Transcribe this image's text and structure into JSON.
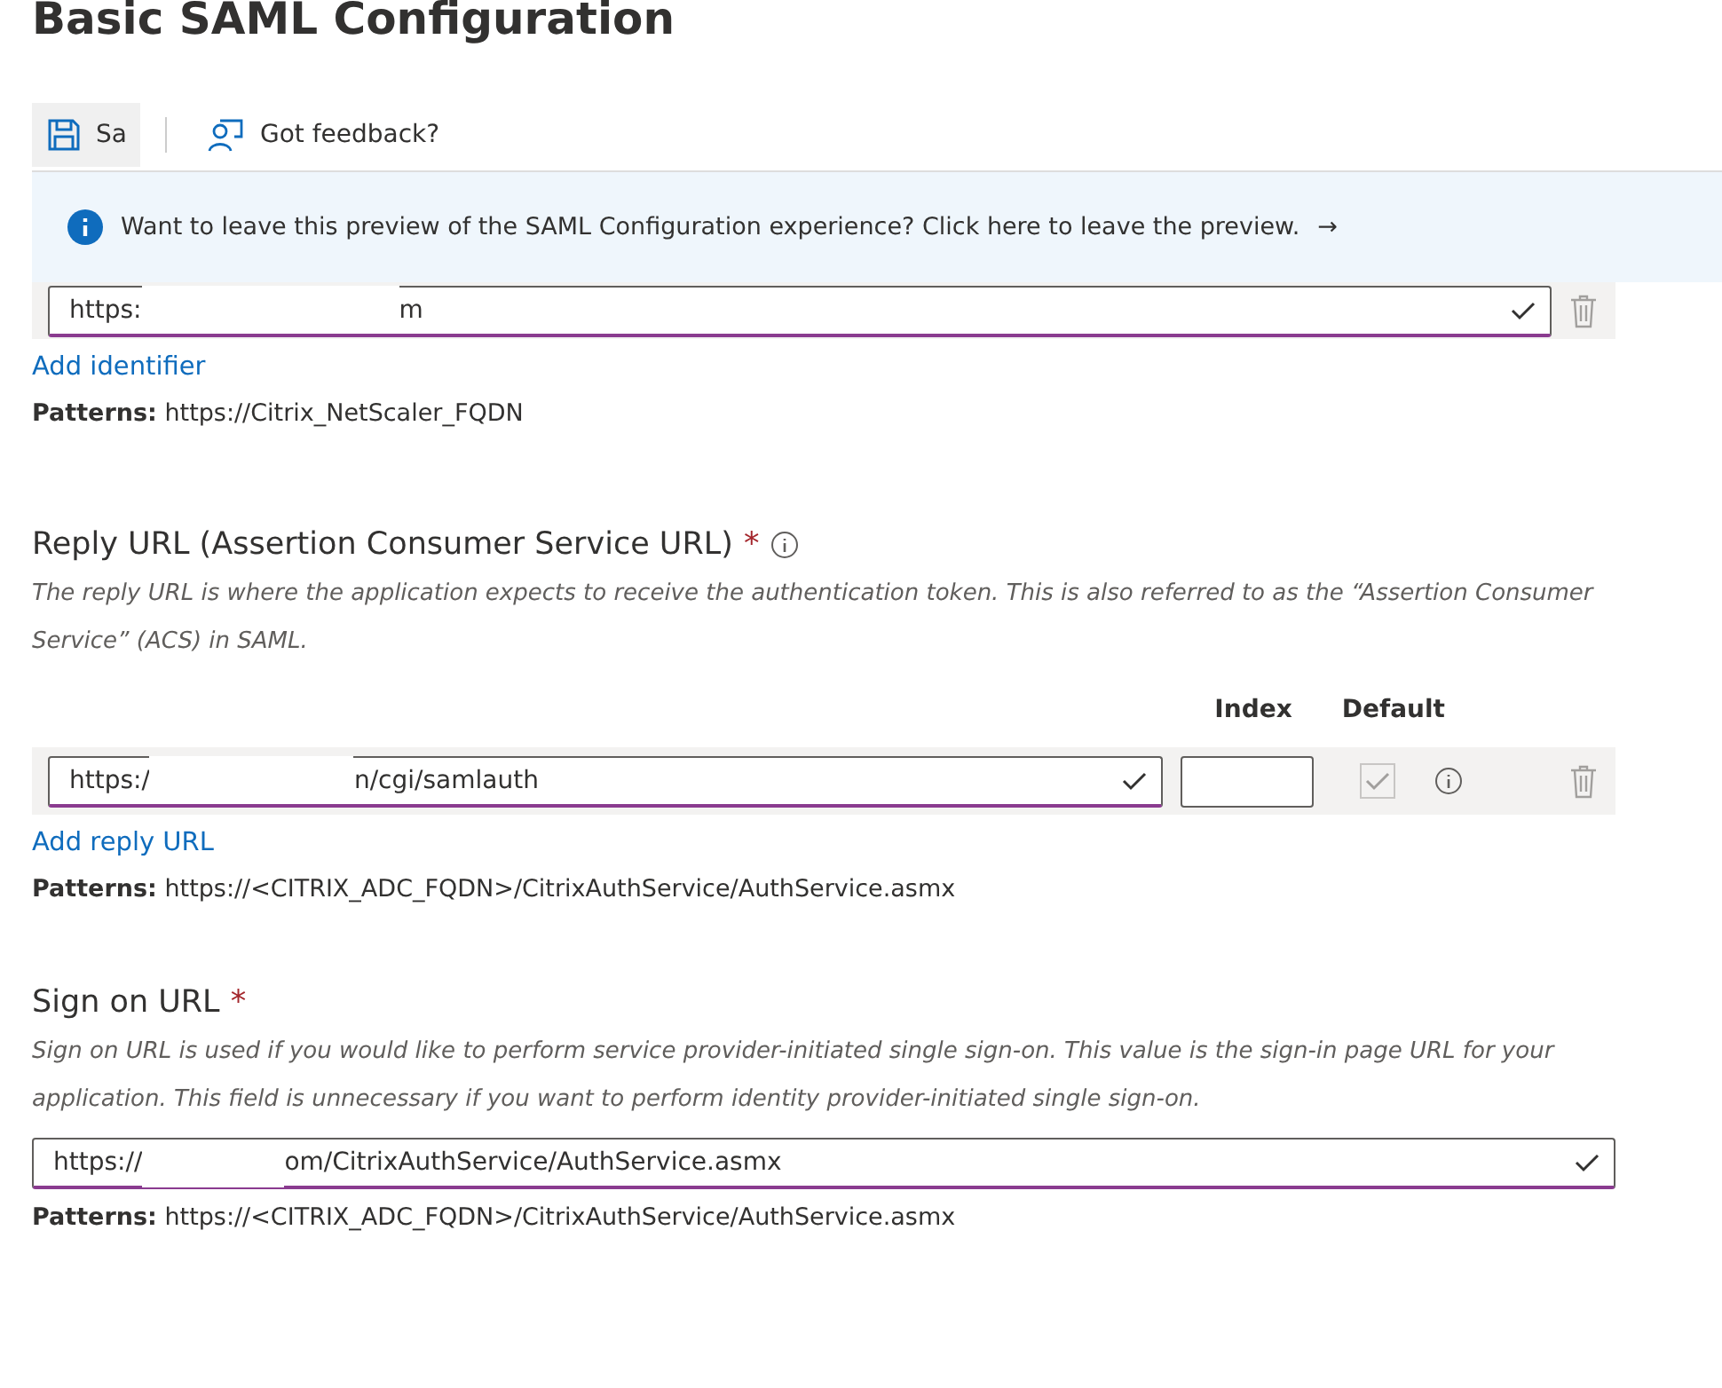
{
  "title": "Basic SAML Configuration",
  "toolbar": {
    "save_label": "Sa",
    "feedback_label": "Got feedback?"
  },
  "banner": {
    "text": "Want to leave this preview of the SAML Configuration experience? Click here to leave the preview.",
    "arrow": "→"
  },
  "identifier": {
    "value_start": "https:",
    "value_end": "m",
    "valid": true,
    "add_link": "Add identifier",
    "pattern_label": "Patterns:",
    "pattern": "https://Citrix_NetScaler_FQDN"
  },
  "reply_url": {
    "heading": "Reply URL (Assertion Consumer Service URL)",
    "required_mark": "*",
    "description": "The reply URL is where the application expects to receive the authentication token. This is also referred to as the “Assertion Consumer Service” (ACS) in SAML.",
    "columns": [
      "Index",
      "Default"
    ],
    "value_start": "https:/",
    "value_end": "n/cgi/samlauth",
    "valid": true,
    "default_checked": true,
    "default_disabled": true,
    "add_link": "Add reply URL",
    "pattern_label": "Patterns:",
    "pattern": "https://<CITRIX_ADC_FQDN>/CitrixAuthService/AuthService.asmx"
  },
  "sign_on_url": {
    "heading": "Sign on URL",
    "required_mark": "*",
    "description": "Sign on URL is used if you would like to perform service provider-initiated single sign-on. This value is the sign-in page URL for your application. This field is unnecessary if you want to perform identity provider-initiated single sign-on.",
    "value_start": "https://",
    "value_end": "om/CitrixAuthService/AuthService.asmx",
    "valid": true,
    "pattern_label": "Patterns:",
    "pattern": "https://<CITRIX_ADC_FQDN>/CitrixAuthService/AuthService.asmx"
  }
}
